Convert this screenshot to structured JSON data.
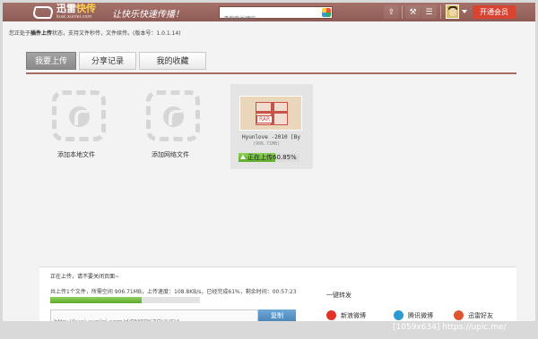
{
  "header": {
    "brand_prefix": "迅雷",
    "brand_suffix": "快传",
    "brand_url": "kuai.xunlei.com",
    "slogan": "让快乐快速传播！",
    "search_placeholder": "请搜索关键字",
    "vip_label": "开通会员"
  },
  "statusbar": {
    "prefix": "您正处于",
    "mode": "插件上传",
    "suffix": "状态，支持文件秒传，文件续传。(版本号：1.0.1.14)"
  },
  "tabs": [
    {
      "label": "我要上传",
      "active": true
    },
    {
      "label": "分享记录",
      "active": false
    },
    {
      "label": "我的收藏",
      "active": false
    }
  ],
  "actions": {
    "local_label": "添加本地文件",
    "network_label": "添加网络文件"
  },
  "file": {
    "icon_label": "RAR",
    "name": "Hyunlove -2010 [By",
    "size": "(906.71MB)",
    "progress_text": "正在上传60.85%",
    "progress": 0.6085
  },
  "panel": {
    "note": "正在上传，请不要关闭页面~",
    "stats": "共上传1个文件，所需空间 906.71MB，上传速度：108.8KB/s，已经完成61%，剩余时间：00:57:23",
    "progress": 0.61,
    "link": "http://kuai.xunlei.com/d/PMBPKZQUUFIA",
    "copy_label": "复制",
    "share_title": "一键转发",
    "shares": [
      {
        "label": "新浪微博",
        "color": "#e2322a"
      },
      {
        "label": "腾讯微博",
        "color": "#2b9bd6"
      },
      {
        "label": "迅雷好友",
        "color": "#e0552f"
      }
    ]
  },
  "watermark": "[1059x634] https://upic.me/"
}
